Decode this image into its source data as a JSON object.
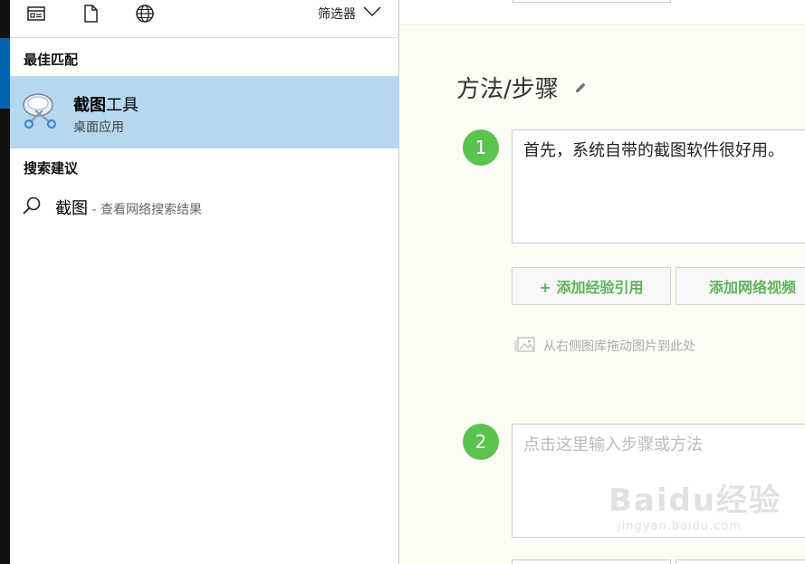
{
  "search": {
    "filter_label": "筛选器",
    "best_match_label": "最佳匹配",
    "best_match": {
      "title_bold": "截图",
      "title_rest": "工具",
      "subtitle": "桌面应用"
    },
    "suggestions_label": "搜索建议",
    "suggestion": {
      "query": "截图",
      "hint": " - 查看网络搜索结果"
    }
  },
  "editor": {
    "heading": "方法/步骤",
    "steps": [
      {
        "number": "1",
        "text": "首先，系统自带的截图软件很好用。"
      },
      {
        "number": "2",
        "placeholder": "点击这里输入步骤或方法"
      }
    ],
    "add_reference_button": "+ 添加经验引用",
    "add_video_button": "添加网络视频",
    "drag_hint": "从右侧图库拖动图片到此处"
  },
  "watermark": {
    "main": "Baidu经验",
    "sub": "jingyan.baidu.com"
  }
}
